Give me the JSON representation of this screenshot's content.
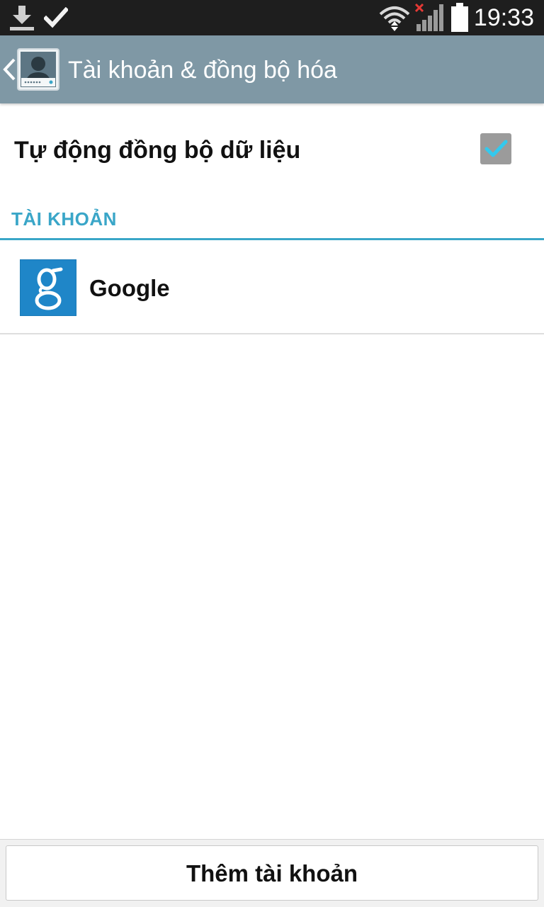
{
  "status_bar": {
    "time": "19:33",
    "left_icons": [
      "download-icon",
      "check-icon"
    ],
    "right_icons": [
      "wifi-icon",
      "signal-icon",
      "battery-icon"
    ]
  },
  "action_bar": {
    "title": "Tài khoản & đồng bộ hóa",
    "icon": "accounts-icon",
    "color": "#7f98a5"
  },
  "auto_sync": {
    "label": "Tự động đồng bộ dữ liệu",
    "checked": true
  },
  "accounts_section": {
    "title": "TÀI KHOẢN",
    "accent_color": "#3aa6c8",
    "items": [
      {
        "label": "Google",
        "icon": "google-icon"
      }
    ]
  },
  "footer": {
    "add_account_label": "Thêm tài khoản"
  }
}
